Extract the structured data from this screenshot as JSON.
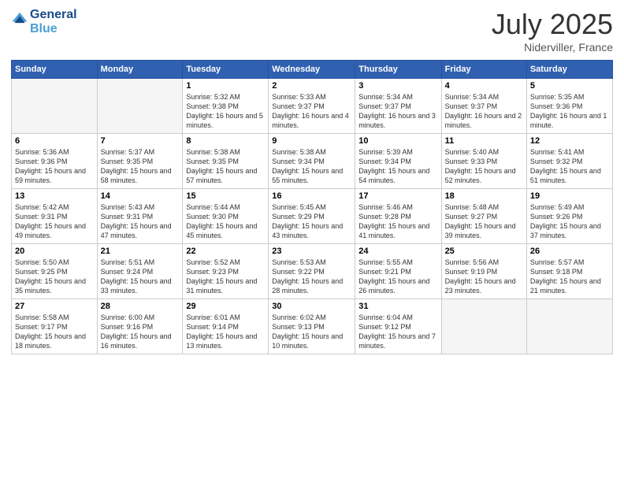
{
  "header": {
    "logo_line1": "General",
    "logo_line2": "Blue",
    "month_year": "July 2025",
    "location": "Niderviller, France"
  },
  "days_of_week": [
    "Sunday",
    "Monday",
    "Tuesday",
    "Wednesday",
    "Thursday",
    "Friday",
    "Saturday"
  ],
  "weeks": [
    [
      {
        "day": "",
        "empty": true
      },
      {
        "day": "",
        "empty": true
      },
      {
        "day": "1",
        "sunrise": "5:32 AM",
        "sunset": "9:38 PM",
        "daylight": "16 hours and 5 minutes."
      },
      {
        "day": "2",
        "sunrise": "5:33 AM",
        "sunset": "9:37 PM",
        "daylight": "16 hours and 4 minutes."
      },
      {
        "day": "3",
        "sunrise": "5:34 AM",
        "sunset": "9:37 PM",
        "daylight": "16 hours and 3 minutes."
      },
      {
        "day": "4",
        "sunrise": "5:34 AM",
        "sunset": "9:37 PM",
        "daylight": "16 hours and 2 minutes."
      },
      {
        "day": "5",
        "sunrise": "5:35 AM",
        "sunset": "9:36 PM",
        "daylight": "16 hours and 1 minute."
      }
    ],
    [
      {
        "day": "6",
        "sunrise": "5:36 AM",
        "sunset": "9:36 PM",
        "daylight": "15 hours and 59 minutes."
      },
      {
        "day": "7",
        "sunrise": "5:37 AM",
        "sunset": "9:35 PM",
        "daylight": "15 hours and 58 minutes."
      },
      {
        "day": "8",
        "sunrise": "5:38 AM",
        "sunset": "9:35 PM",
        "daylight": "15 hours and 57 minutes."
      },
      {
        "day": "9",
        "sunrise": "5:38 AM",
        "sunset": "9:34 PM",
        "daylight": "15 hours and 55 minutes."
      },
      {
        "day": "10",
        "sunrise": "5:39 AM",
        "sunset": "9:34 PM",
        "daylight": "15 hours and 54 minutes."
      },
      {
        "day": "11",
        "sunrise": "5:40 AM",
        "sunset": "9:33 PM",
        "daylight": "15 hours and 52 minutes."
      },
      {
        "day": "12",
        "sunrise": "5:41 AM",
        "sunset": "9:32 PM",
        "daylight": "15 hours and 51 minutes."
      }
    ],
    [
      {
        "day": "13",
        "sunrise": "5:42 AM",
        "sunset": "9:31 PM",
        "daylight": "15 hours and 49 minutes."
      },
      {
        "day": "14",
        "sunrise": "5:43 AM",
        "sunset": "9:31 PM",
        "daylight": "15 hours and 47 minutes."
      },
      {
        "day": "15",
        "sunrise": "5:44 AM",
        "sunset": "9:30 PM",
        "daylight": "15 hours and 45 minutes."
      },
      {
        "day": "16",
        "sunrise": "5:45 AM",
        "sunset": "9:29 PM",
        "daylight": "15 hours and 43 minutes."
      },
      {
        "day": "17",
        "sunrise": "5:46 AM",
        "sunset": "9:28 PM",
        "daylight": "15 hours and 41 minutes."
      },
      {
        "day": "18",
        "sunrise": "5:48 AM",
        "sunset": "9:27 PM",
        "daylight": "15 hours and 39 minutes."
      },
      {
        "day": "19",
        "sunrise": "5:49 AM",
        "sunset": "9:26 PM",
        "daylight": "15 hours and 37 minutes."
      }
    ],
    [
      {
        "day": "20",
        "sunrise": "5:50 AM",
        "sunset": "9:25 PM",
        "daylight": "15 hours and 35 minutes."
      },
      {
        "day": "21",
        "sunrise": "5:51 AM",
        "sunset": "9:24 PM",
        "daylight": "15 hours and 33 minutes."
      },
      {
        "day": "22",
        "sunrise": "5:52 AM",
        "sunset": "9:23 PM",
        "daylight": "15 hours and 31 minutes."
      },
      {
        "day": "23",
        "sunrise": "5:53 AM",
        "sunset": "9:22 PM",
        "daylight": "15 hours and 28 minutes."
      },
      {
        "day": "24",
        "sunrise": "5:55 AM",
        "sunset": "9:21 PM",
        "daylight": "15 hours and 26 minutes."
      },
      {
        "day": "25",
        "sunrise": "5:56 AM",
        "sunset": "9:19 PM",
        "daylight": "15 hours and 23 minutes."
      },
      {
        "day": "26",
        "sunrise": "5:57 AM",
        "sunset": "9:18 PM",
        "daylight": "15 hours and 21 minutes."
      }
    ],
    [
      {
        "day": "27",
        "sunrise": "5:58 AM",
        "sunset": "9:17 PM",
        "daylight": "15 hours and 18 minutes."
      },
      {
        "day": "28",
        "sunrise": "6:00 AM",
        "sunset": "9:16 PM",
        "daylight": "15 hours and 16 minutes."
      },
      {
        "day": "29",
        "sunrise": "6:01 AM",
        "sunset": "9:14 PM",
        "daylight": "15 hours and 13 minutes."
      },
      {
        "day": "30",
        "sunrise": "6:02 AM",
        "sunset": "9:13 PM",
        "daylight": "15 hours and 10 minutes."
      },
      {
        "day": "31",
        "sunrise": "6:04 AM",
        "sunset": "9:12 PM",
        "daylight": "15 hours and 7 minutes."
      },
      {
        "day": "",
        "empty": true
      },
      {
        "day": "",
        "empty": true
      }
    ]
  ],
  "colors": {
    "header_bg": "#3060b0",
    "header_text": "#ffffff",
    "title_color": "#333333",
    "logo_blue": "#1a4b8c",
    "logo_light": "#4a9fd4"
  }
}
